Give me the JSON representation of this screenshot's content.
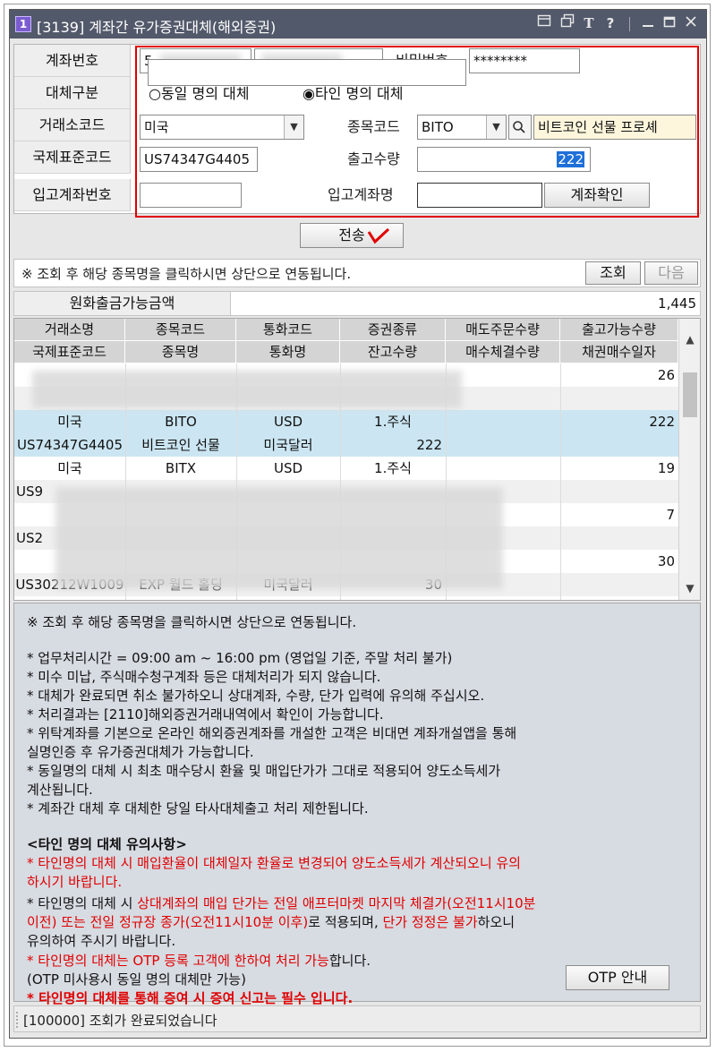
{
  "window": {
    "number": "1",
    "title": "[3139] 계좌간 유가증권대체(해외증권)",
    "icons": [
      "screen-icon",
      "window-icon",
      "font-icon",
      "help-icon",
      "minimize-icon",
      "maximize-icon",
      "close-icon"
    ]
  },
  "form": {
    "account_label": "계좌번호",
    "account_value": "5",
    "password_label": "비밀번호",
    "password_value": "********",
    "transfer_type_label": "대체구분",
    "radio_same": "○동일 명의 대체",
    "radio_other": "◉타인 명의 대체",
    "exchange_label": "거래소코드",
    "exchange_value": "미국",
    "symbol_label": "종목코드",
    "symbol_value": "BITO",
    "symbol_name": "비트코인 선물 프로셰",
    "isin_label": "국제표준코드",
    "isin_value": "US74347G4405",
    "outqty_label": "출고수량",
    "outqty_value": "222",
    "in_account_label": "입고계좌번호",
    "in_account_name_label": "입고계좌명",
    "account_check_button": "계좌확인"
  },
  "send_button": "전송",
  "notice": {
    "text": "※ 조회 후 해당 종목명을 클릭하시면 상단으로 연동됩니다.",
    "query_button": "조회",
    "next_button": "다음"
  },
  "amount": {
    "label": "원화출금가능금액",
    "value": "1,445"
  },
  "grid": {
    "header_row1": [
      "거래소명",
      "종목코드",
      "통화코드",
      "증권종류",
      "매도주문수량",
      "출고가능수량"
    ],
    "header_row2": [
      "국제표준코드",
      "종목명",
      "통화명",
      "잔고수량",
      "매수체결수량",
      "채권매수일자"
    ],
    "rows": [
      [
        "",
        "",
        "",
        "",
        "",
        "26"
      ],
      [
        "",
        "",
        "",
        "",
        "",
        ""
      ],
      [
        "미국",
        "BITO",
        "USD",
        "1.주식",
        "",
        "222"
      ],
      [
        "US74347G4405",
        "비트코인 선물",
        "미국달러",
        "222",
        "",
        ""
      ],
      [
        "미국",
        "BITX",
        "USD",
        "1.주식",
        "",
        "19"
      ],
      [
        "US9",
        "",
        "",
        "",
        "",
        ""
      ],
      [
        "",
        "",
        "",
        "",
        "",
        "7"
      ],
      [
        "US2",
        "",
        "",
        "",
        "",
        ""
      ],
      [
        "",
        "",
        "",
        "",
        "",
        "30"
      ],
      [
        "US30212W1009",
        "EXP 월드 홀딩",
        "미국달러",
        "30",
        "",
        ""
      ]
    ]
  },
  "info": {
    "head": "※ 조회 후 해당 종목명을 클릭하시면 상단으로 연동됩니다.",
    "lines": [
      "* 업무처리시간 = 09:00 am ~ 16:00 pm (영업일 기준, 주말 처리 불가)",
      "* 미수 미납, 주식매수청구계좌 등은 대체처리가 되지 않습니다.",
      "* 대체가 완료되면 취소 불가하오니 상대계좌, 수량, 단가 입력에 유의해 주십시오.",
      "* 처리결과는 [2110]해외증권거래내역에서 확인이 가능합니다.",
      "* 위탁계좌를 기본으로 온라인 해외증권계좌를 개설한 고객은 비대면 계좌개설앱을 통해",
      "  실명인증 후 유가증권대체가 가능합니다.",
      "* 동일명의 대체 시 최초 매수당시 환율 및 매입단가가 그대로 적용되어 양도소득세가",
      "  계산됩니다.",
      "* 계좌간 대체 후 대체한 당일 타사대체출고 처리 제한됩니다."
    ],
    "caution_title": "<타인 명의 대체 유의사항>",
    "c1a": "* 타인명의 대체 시 매입환율이 대체일자 환율로 변경되어 양도소득세가 계산되오니 유의",
    "c1b": "  하시기 바랍니다.",
    "c2a_black": "* 타인명의 대체 시 ",
    "c2a_red": "상대계좌의 매입 단가는 전일 애프터마켓 마지막 체결가(오전11시10분",
    "c2b_red": "  이전) 또는 전일 정규장 종가(오전11시10분 이후)",
    "c2b_black1": "로 적용되며, ",
    "c2b_red2": "단가 정정은 불가",
    "c2b_black2": "하오니",
    "c2c": "  유의하여 주시기 바랍니다.",
    "c3_red": "* 타인명의 대체는 OTP 등록 고객에 한하여 처리 가능",
    "c3_black": "합니다.",
    "c3b": "  (OTP 미사용시 동일 명의 대체만 가능)",
    "c4": "* 타인명의 대체를 통해 증여 시 증여 신고는 필수 입니다.",
    "otp_button": "OTP 안내"
  },
  "status": {
    "text": "[100000] 조회가 완료되었습니다"
  },
  "colors": {
    "title_bar": "#52596a",
    "highlight_box": "#e00000",
    "selected_row": "#cbe6f2",
    "info_bg": "#d7dbe2",
    "warning_text": "#e00000"
  }
}
